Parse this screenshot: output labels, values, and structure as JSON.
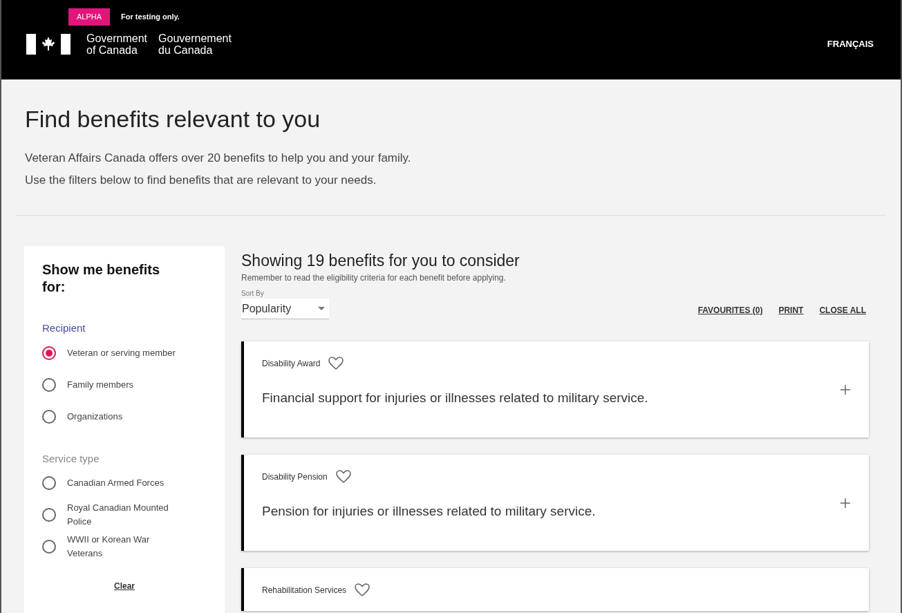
{
  "banner": {
    "badge": "ALPHA",
    "note": "For testing only."
  },
  "header": {
    "org_en": [
      "Government",
      "of Canada"
    ],
    "org_fr": [
      "Gouvernement",
      "du Canada"
    ],
    "language_link": "FRANÇAIS"
  },
  "intro": {
    "title": "Find benefits relevant to you",
    "lines": [
      "Veteran Affairs Canada offers over 20 benefits to help you and your family.",
      "Use the filters below to find benefits that are relevant to your needs."
    ]
  },
  "filters": {
    "title": "Show me benefits for:",
    "groups": [
      {
        "title": "Recipient",
        "options": [
          {
            "label": "Veteran or serving member",
            "selected": true
          },
          {
            "label": "Family members",
            "selected": false
          },
          {
            "label": "Organizations",
            "selected": false
          }
        ]
      },
      {
        "title": "Service type",
        "options": [
          {
            "label": "Canadian Armed Forces",
            "selected": false
          },
          {
            "label": "Royal Canadian Mounted Police",
            "selected": false
          },
          {
            "label": "WWII or Korean War Veterans",
            "selected": false
          }
        ]
      }
    ],
    "clear": "Clear"
  },
  "results": {
    "title": "Showing 19 benefits for you to consider",
    "subtitle": "Remember to read the eligibility criteria for each benefit before applying.",
    "sort": {
      "label": "Sort By",
      "value": "Popularity"
    },
    "actions": [
      "FAVOURITES (0)",
      "PRINT",
      "CLOSE ALL"
    ],
    "benefits": [
      {
        "name": "Disability Award",
        "favourite": false,
        "description": "Financial support for injuries or illnesses related to military service.",
        "expanded": false
      },
      {
        "name": "Disability Pension",
        "favourite": false,
        "description": "Pension for injuries or illnesses related to military service.",
        "expanded": false
      },
      {
        "name": "Rehabilitation Services",
        "favourite": false
      }
    ]
  }
}
